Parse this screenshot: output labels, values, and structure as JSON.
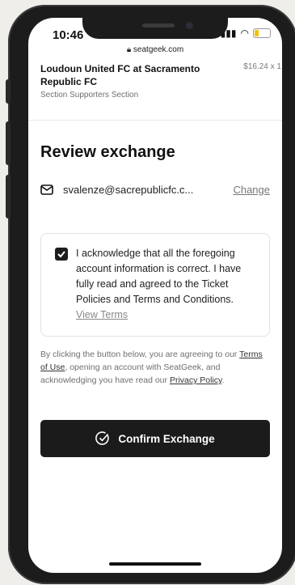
{
  "status_bar": {
    "time": "10:46",
    "url": "seatgeek.com"
  },
  "event": {
    "title": "Loudoun United FC at Sacramento Republic FC",
    "price": "$16.24 x 1",
    "section": "Section Supporters Section"
  },
  "review": {
    "title": "Review exchange",
    "email": "svalenze@sacrepublicfc.c...",
    "change_label": "Change"
  },
  "acknowledgement": {
    "text": "I acknowledge that all the foregoing account information is correct. I have fully read and agreed to the Ticket Policies and Terms and Conditions.",
    "view_terms": "View Terms",
    "checked": true
  },
  "disclaimer": {
    "prefix": "By clicking the button below, you are agreeing to our ",
    "terms_link": "Terms of Use",
    "middle": ", opening an account with SeatGeek, and acknowledging you have read our ",
    "privacy_link": "Privacy Policy",
    "suffix": "."
  },
  "confirm": {
    "label": "Confirm Exchange"
  },
  "colors": {
    "button_bg": "#1b1b1b",
    "muted_text": "#6f6f6f",
    "border": "#e2e2e2"
  },
  "icons": [
    "lock-icon",
    "signal-icon",
    "wifi-icon",
    "battery-icon",
    "mail-icon",
    "checkbox-icon",
    "check-circle-icon"
  ]
}
